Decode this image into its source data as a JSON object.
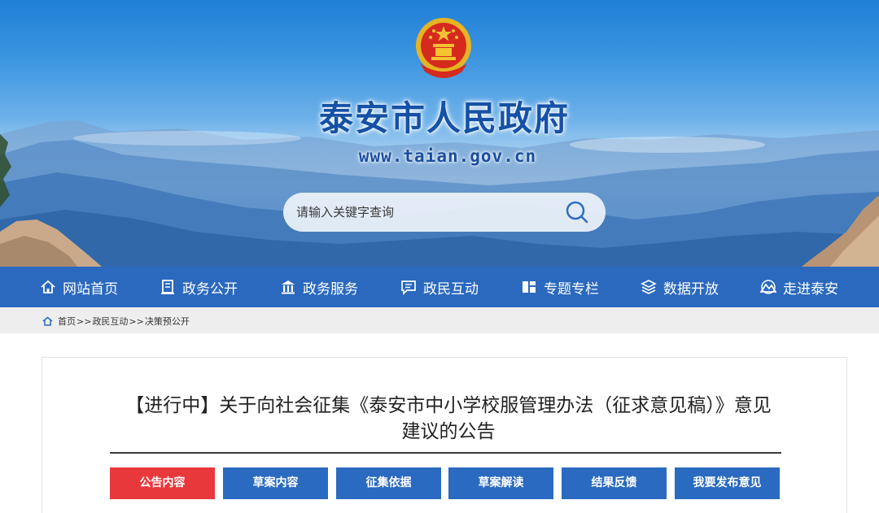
{
  "site": {
    "title": "泰安市人民政府",
    "url": "www.taian.gov.cn"
  },
  "search": {
    "placeholder": "请输入关键字查询"
  },
  "nav": {
    "items": [
      {
        "label": "网站首页",
        "icon": "home-icon"
      },
      {
        "label": "政务公开",
        "icon": "document-icon"
      },
      {
        "label": "政务服务",
        "icon": "building-icon"
      },
      {
        "label": "政民互动",
        "icon": "chat-icon"
      },
      {
        "label": "专题专栏",
        "icon": "bookmark-icon"
      },
      {
        "label": "数据开放",
        "icon": "layers-icon"
      },
      {
        "label": "走进泰安",
        "icon": "mountain-icon"
      }
    ]
  },
  "breadcrumb": {
    "items": [
      "首页",
      "政民互动",
      "决策预公开"
    ],
    "separator": ">>"
  },
  "article": {
    "title": "【进行中】关于向社会征集《泰安市中小学校服管理办法（征求意见稿）》意见建议的公告"
  },
  "tabs": {
    "items": [
      "公告内容",
      "草案内容",
      "征集依据",
      "草案解读",
      "结果反馈",
      "我要发布意见"
    ],
    "active_index": 0
  },
  "colors": {
    "nav_bg": "#2b69bf",
    "tab_bg": "#2a6ac0",
    "tab_active_bg": "#e8383c",
    "title_color": "#1551a6"
  }
}
